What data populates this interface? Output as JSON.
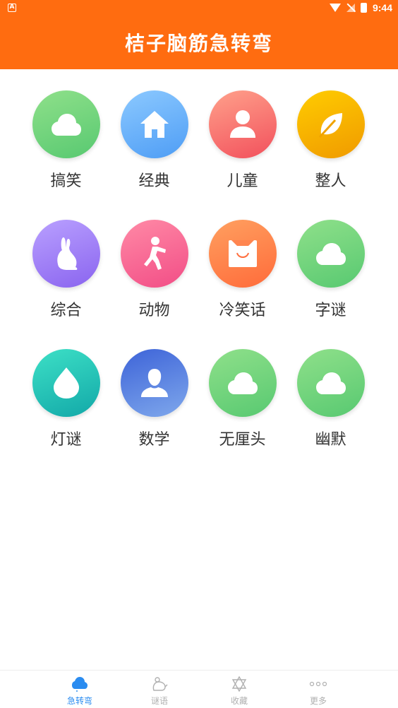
{
  "status_bar": {
    "time": "9:44",
    "app_icon_letter": "A"
  },
  "header": {
    "title": "桔子脑筋急转弯"
  },
  "categories": [
    {
      "label": "搞笑",
      "icon": "cloud-icon",
      "color": "green"
    },
    {
      "label": "经典",
      "icon": "house-icon",
      "color": "blue"
    },
    {
      "label": "儿童",
      "icon": "person-icon",
      "color": "red"
    },
    {
      "label": "整人",
      "icon": "leaf-icon",
      "color": "amber"
    },
    {
      "label": "综合",
      "icon": "rabbit-icon",
      "color": "purple"
    },
    {
      "label": "动物",
      "icon": "running-person-icon",
      "color": "pink"
    },
    {
      "label": "冷笑话",
      "icon": "smile-bag-icon",
      "color": "orange"
    },
    {
      "label": "字谜",
      "icon": "cloud-icon",
      "color": "green"
    },
    {
      "label": "灯谜",
      "icon": "water-drop-icon",
      "color": "teal"
    },
    {
      "label": "数学",
      "icon": "user-silhouette-icon",
      "color": "navy"
    },
    {
      "label": "无厘头",
      "icon": "cloud-icon",
      "color": "green"
    },
    {
      "label": "幽默",
      "icon": "cloud-icon",
      "color": "green"
    }
  ],
  "tabs": [
    {
      "label": "急转弯",
      "icon": "cloud-icon",
      "active": true
    },
    {
      "label": "谜语",
      "icon": "dragon-icon",
      "active": false
    },
    {
      "label": "收藏",
      "icon": "star-icon",
      "active": false
    },
    {
      "label": "更多",
      "icon": "more-dots-icon",
      "active": false
    }
  ],
  "colors": {
    "header": "#ff6c10",
    "active_tab": "#2b8cf0",
    "inactive_tab": "#b0b0b0"
  }
}
